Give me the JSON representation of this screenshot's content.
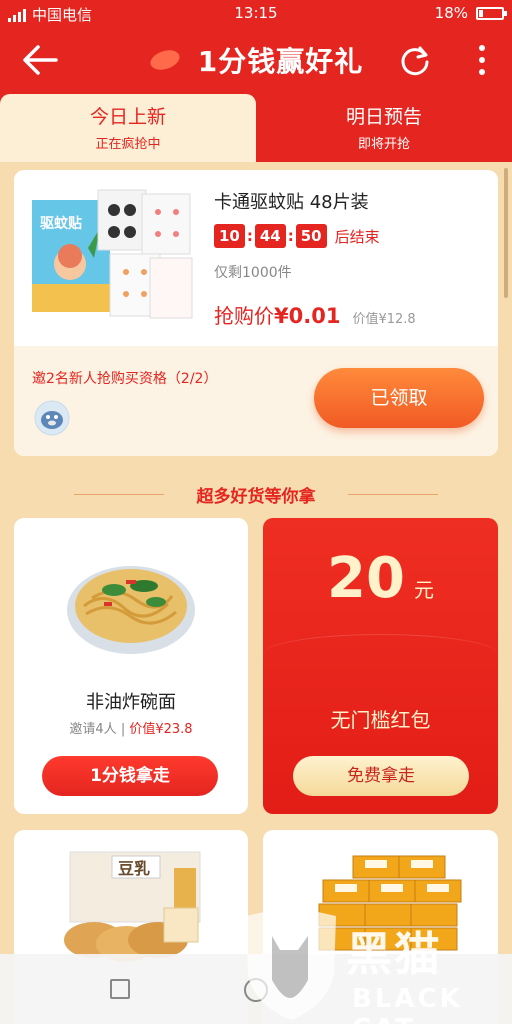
{
  "status_bar": {
    "left_text": "中国电信",
    "time": "13:15",
    "battery": "18%",
    "battery_level": 0.18
  },
  "header": {
    "title": "1分钱赢好礼",
    "back_icon": "back-arrow-icon",
    "refresh_icon": "refresh-icon",
    "more_icon": "more-vertical-icon"
  },
  "tabs": [
    {
      "title": "今日上新",
      "subtitle": "正在疯抢中",
      "active": true
    },
    {
      "title": "明日预告",
      "subtitle": "即将开抢",
      "active": false
    }
  ],
  "featured": {
    "name": "卡通驱蚊贴 48片装",
    "countdown": {
      "h": "10",
      "m": "44",
      "s": "50",
      "suffix": "后结束"
    },
    "stock": "仅剩1000件",
    "price_label": "抢购价",
    "price": "¥0.01",
    "original_price": "价值¥12.8",
    "invite_text": "邀2名新人抢购买资格（2/2）",
    "claimed_button": "已领取"
  },
  "section": {
    "title": "超多好货等你拿"
  },
  "products": {
    "noodle": {
      "name": "非油炸碗面",
      "invite": "邀请4人",
      "separator": "|",
      "value": "价值¥23.8",
      "button": "1分钱拿走"
    },
    "redpacket": {
      "amount": "20",
      "unit": "元",
      "desc": "无门槛红包",
      "button": "免费拿走"
    }
  },
  "watermark": {
    "cn": "黑猫",
    "en": "BLACK CAT"
  },
  "colors": {
    "brand_red": "#e42520",
    "background": "#f6dcae",
    "orange_button": "#f15a24",
    "gold": "#fff1c9"
  }
}
